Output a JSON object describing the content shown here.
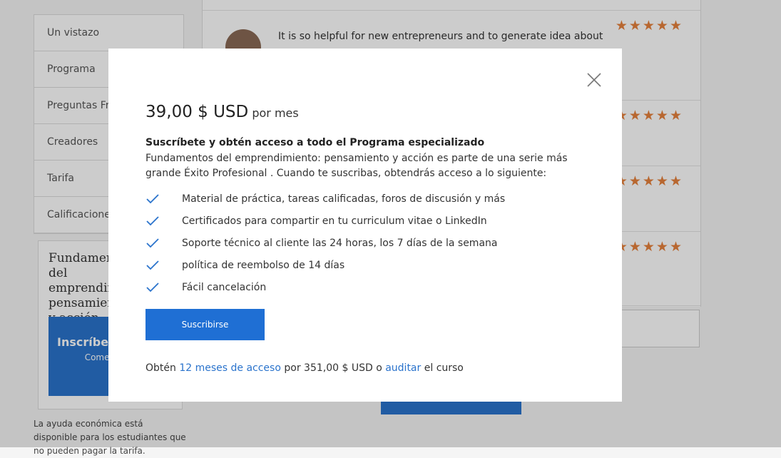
{
  "background": {
    "sidebar": {
      "items": [
        "Un vistazo",
        "Programa",
        "Preguntas Frecuentes",
        "Creadores",
        "Tarifa",
        "Calificaciones"
      ]
    },
    "promo": {
      "title": "Fundamentos del emprendimiento: pensamiento y acción",
      "button_label": "Inscríbete ahora",
      "button_sub": "Comenzó el"
    },
    "aid_text": "La ayuda económica está disponible para los estudiantes que no pueden pagar la tarifa.",
    "reviews": [
      {
        "text": "It is so helpful for new entrepreneurs and to generate idea about",
        "stars": "★★★★★"
      },
      {
        "text": "",
        "stars": "★★★★★"
      },
      {
        "text": "",
        "stars": "★★★★★"
      },
      {
        "text": "",
        "stars": "★★★★★"
      }
    ]
  },
  "modal": {
    "close_icon": "close-icon",
    "price": "39,00 $ USD",
    "period": "por mes",
    "headline": "Suscríbete y obtén acceso a todo el Programa especializado",
    "description": "Fundamentos del emprendimiento: pensamiento y acción es parte de una serie más grande Éxito Profesional . Cuando te suscribas, obtendrás acceso a lo siguiente:",
    "benefits": [
      "Material de práctica, tareas calificadas, foros de discusión y más",
      "Certificados para compartir en tu curriculum vitae o LinkedIn",
      "Soporte técnico al cliente las 24 horas, los 7 días de la semana",
      "política de reembolso de 14 días",
      "Fácil cancelación"
    ],
    "subscribe_label": "Suscribirse",
    "footer": {
      "prefix": "Obtén",
      "link1": "12 meses de acceso",
      "middle": "por 351,00 $ USD o",
      "link2": "auditar",
      "suffix": "el curso"
    }
  },
  "colors": {
    "accent": "#1f6fd4",
    "link": "#2a73cc",
    "check": "#2a73cc",
    "star": "#e6813c"
  }
}
